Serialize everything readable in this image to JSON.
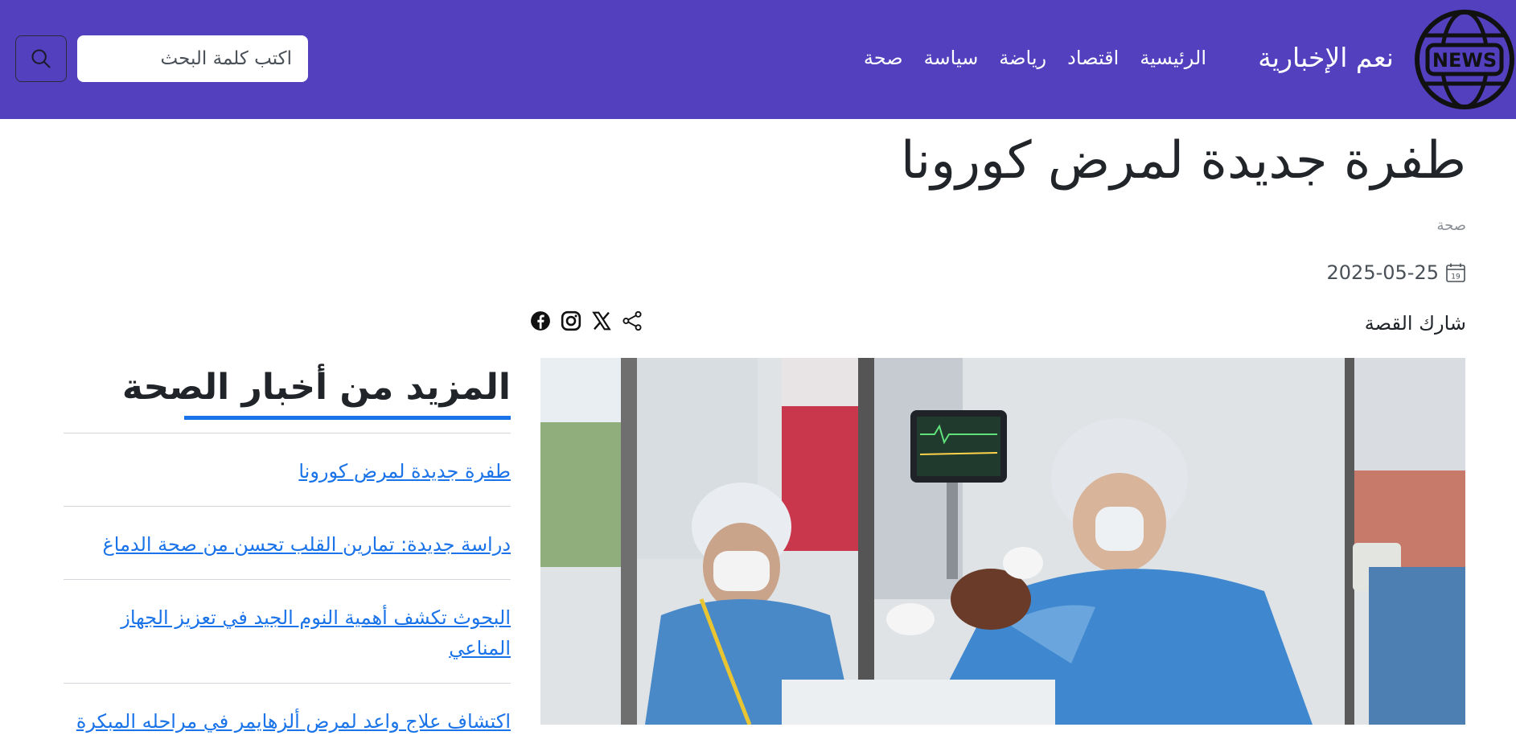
{
  "header": {
    "brand_name": "نعم الإخبارية",
    "logo_text": "NEWS",
    "nav": [
      "الرئيسية",
      "اقتصاد",
      "رياضة",
      "سياسة",
      "صحة"
    ],
    "search_placeholder": "اكتب كلمة البحث",
    "colors": {
      "background": "#5240bf",
      "text": "#ffffff"
    }
  },
  "article": {
    "title": "طفرة جديدة لمرض كورونا",
    "category": "صحة",
    "date": "2025-05-25",
    "calendar_icon_day": "19",
    "share_label": "شارك القصة",
    "social_icons": [
      "facebook-icon",
      "instagram-icon",
      "x-icon",
      "share-icon"
    ]
  },
  "sidebar": {
    "heading": "المزيد من أخبار الصحة",
    "accent": "#1a73e8",
    "items": [
      "طفرة جديدة لمرض كورونا",
      "دراسة جديدة: تمارين القلب تحسن من صحة الدماغ",
      "البحوث تكشف أهمية النوم الجيد في تعزيز الجهاز المناعي",
      "اكتشاف علاج واعد لمرض ألزهايمر في مراحله المبكرة"
    ]
  }
}
